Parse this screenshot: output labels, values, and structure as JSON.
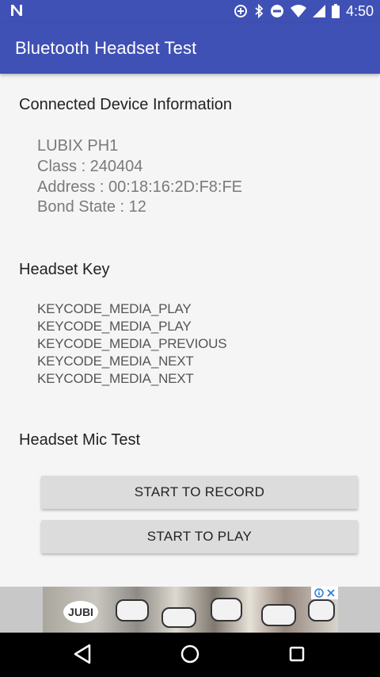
{
  "status_bar": {
    "time": "4:50",
    "battery": "battery-icon",
    "icons": [
      "n-notification-icon",
      "data-saver-icon",
      "bluetooth-icon",
      "do-not-disturb-icon",
      "wifi-icon",
      "cell-signal-icon",
      "battery-icon"
    ]
  },
  "app_bar": {
    "title": "Bluetooth Headset Test",
    "color": "#3f51b5"
  },
  "device_info": {
    "heading": "Connected Device Information",
    "lines": [
      "LUBIX PH1",
      "Class : 240404",
      "Address : 00:18:16:2D:F8:FE",
      "Bond State : 12"
    ]
  },
  "headset_key": {
    "heading": "Headset Key",
    "keys": [
      "KEYCODE_MEDIA_PLAY",
      "KEYCODE_MEDIA_PLAY",
      "KEYCODE_MEDIA_PREVIOUS",
      "KEYCODE_MEDIA_NEXT",
      "KEYCODE_MEDIA_NEXT"
    ]
  },
  "mic_test": {
    "heading": "Headset Mic Test",
    "record_label": "START TO RECORD",
    "play_label": "START TO PLAY"
  },
  "ad": {
    "logo_text": "JUBI",
    "choices_icon": "ad-choices-icon",
    "close_icon": "close-icon"
  },
  "nav_bar": {
    "icons": [
      "back-icon",
      "home-icon",
      "recents-icon"
    ]
  }
}
